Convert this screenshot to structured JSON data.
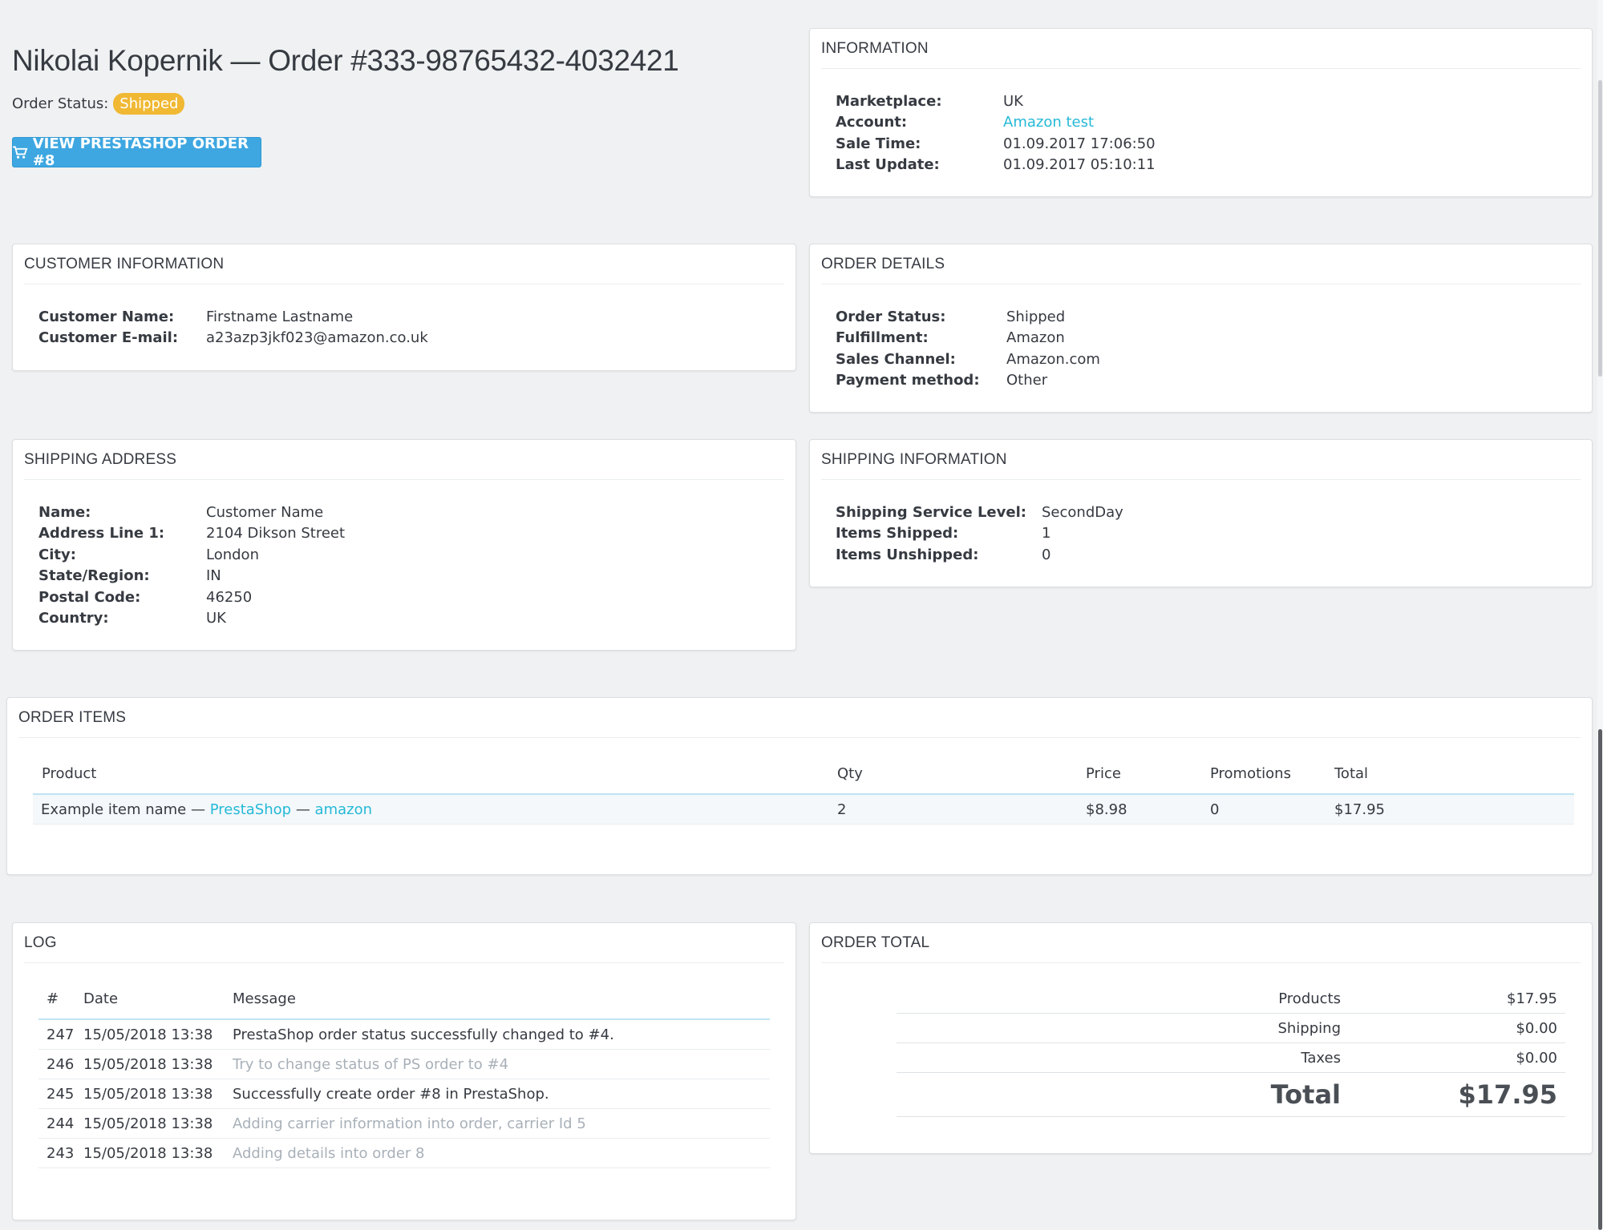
{
  "header": {
    "title": "Nikolai Kopernik — Order #333-98765432-4032421",
    "status_label": "Order Status:",
    "status_value": "Shipped",
    "view_button_label": "VIEW PRESTASHOP ORDER #8"
  },
  "information": {
    "heading": "INFORMATION",
    "rows": [
      {
        "key": "Marketplace:",
        "value": "UK"
      },
      {
        "key": "Account:",
        "value": "Amazon test"
      },
      {
        "key": "Sale Time:",
        "value": "01.09.2017 17:06:50"
      },
      {
        "key": "Last Update:",
        "value": "01.09.2017 05:10:11"
      }
    ]
  },
  "customer": {
    "heading": "CUSTOMER INFORMATION",
    "rows": [
      {
        "key": "Customer Name:",
        "value": "Firstname Lastname"
      },
      {
        "key": "Customer E-mail:",
        "value": "a23azp3jkf023@amazon.co.uk"
      }
    ]
  },
  "order_details": {
    "heading": "ORDER DETAILS",
    "rows": [
      {
        "key": "Order Status:",
        "value": "Shipped"
      },
      {
        "key": "Fulfillment:",
        "value": "Amazon"
      },
      {
        "key": "Sales Channel:",
        "value": "Amazon.com"
      },
      {
        "key": "Payment method:",
        "value": "Other"
      }
    ]
  },
  "shipping_address": {
    "heading": "SHIPPING ADDRESS",
    "rows": [
      {
        "key": "Name:",
        "value": "Customer Name"
      },
      {
        "key": "Address Line 1:",
        "value": "2104 Dikson Street"
      },
      {
        "key": "City:",
        "value": "London"
      },
      {
        "key": "State/Region:",
        "value": "IN"
      },
      {
        "key": "Postal Code:",
        "value": "46250"
      },
      {
        "key": "Country:",
        "value": "UK"
      }
    ]
  },
  "shipping_info": {
    "heading": "SHIPPING INFORMATION",
    "rows": [
      {
        "key": "Shipping Service Level:",
        "value": "SecondDay"
      },
      {
        "key": "Items Shipped:",
        "value": "1"
      },
      {
        "key": "Items Unshipped:",
        "value": "0"
      }
    ]
  },
  "order_items": {
    "heading": "ORDER ITEMS",
    "columns": [
      "Product",
      "Qty",
      "Price",
      "Promotions",
      "Total"
    ],
    "rows": [
      {
        "name": "Example item name",
        "sep1": "—",
        "link1": "PrestaShop",
        "sep2": "—",
        "link2": "amazon",
        "qty": "2",
        "price": "$8.98",
        "promotions": "0",
        "total": "$17.95"
      }
    ]
  },
  "log": {
    "heading": "LOG",
    "columns": [
      "#",
      "Date",
      "Message"
    ],
    "rows": [
      {
        "id": "247",
        "date": "15/05/2018 13:38",
        "message": "PrestaShop order status successfully changed to #4.",
        "muted": false
      },
      {
        "id": "246",
        "date": "15/05/2018 13:38",
        "message": "Try to change status of PS order to #4",
        "muted": true
      },
      {
        "id": "245",
        "date": "15/05/2018 13:38",
        "message": "Successfully create order #8 in PrestaShop.",
        "muted": false
      },
      {
        "id": "244",
        "date": "15/05/2018 13:38",
        "message": "Adding carrier information into order, carrier Id 5",
        "muted": true
      },
      {
        "id": "243",
        "date": "15/05/2018 13:38",
        "message": "Adding details into order 8",
        "muted": true
      }
    ]
  },
  "order_total": {
    "heading": "ORDER TOTAL",
    "products_label": "Products",
    "products_value": "$17.95",
    "shipping_label": "Shipping",
    "shipping_value": "$0.00",
    "taxes_label": "Taxes",
    "taxes_value": "$0.00",
    "total_label": "Total",
    "total_value": "$17.95"
  },
  "colors": {
    "accent": "#25b9d7",
    "button": "#3ea7e1",
    "badge": "#f0b833",
    "background": "#eff1f2"
  },
  "icons": {
    "view_button": "shopping-cart-icon"
  }
}
